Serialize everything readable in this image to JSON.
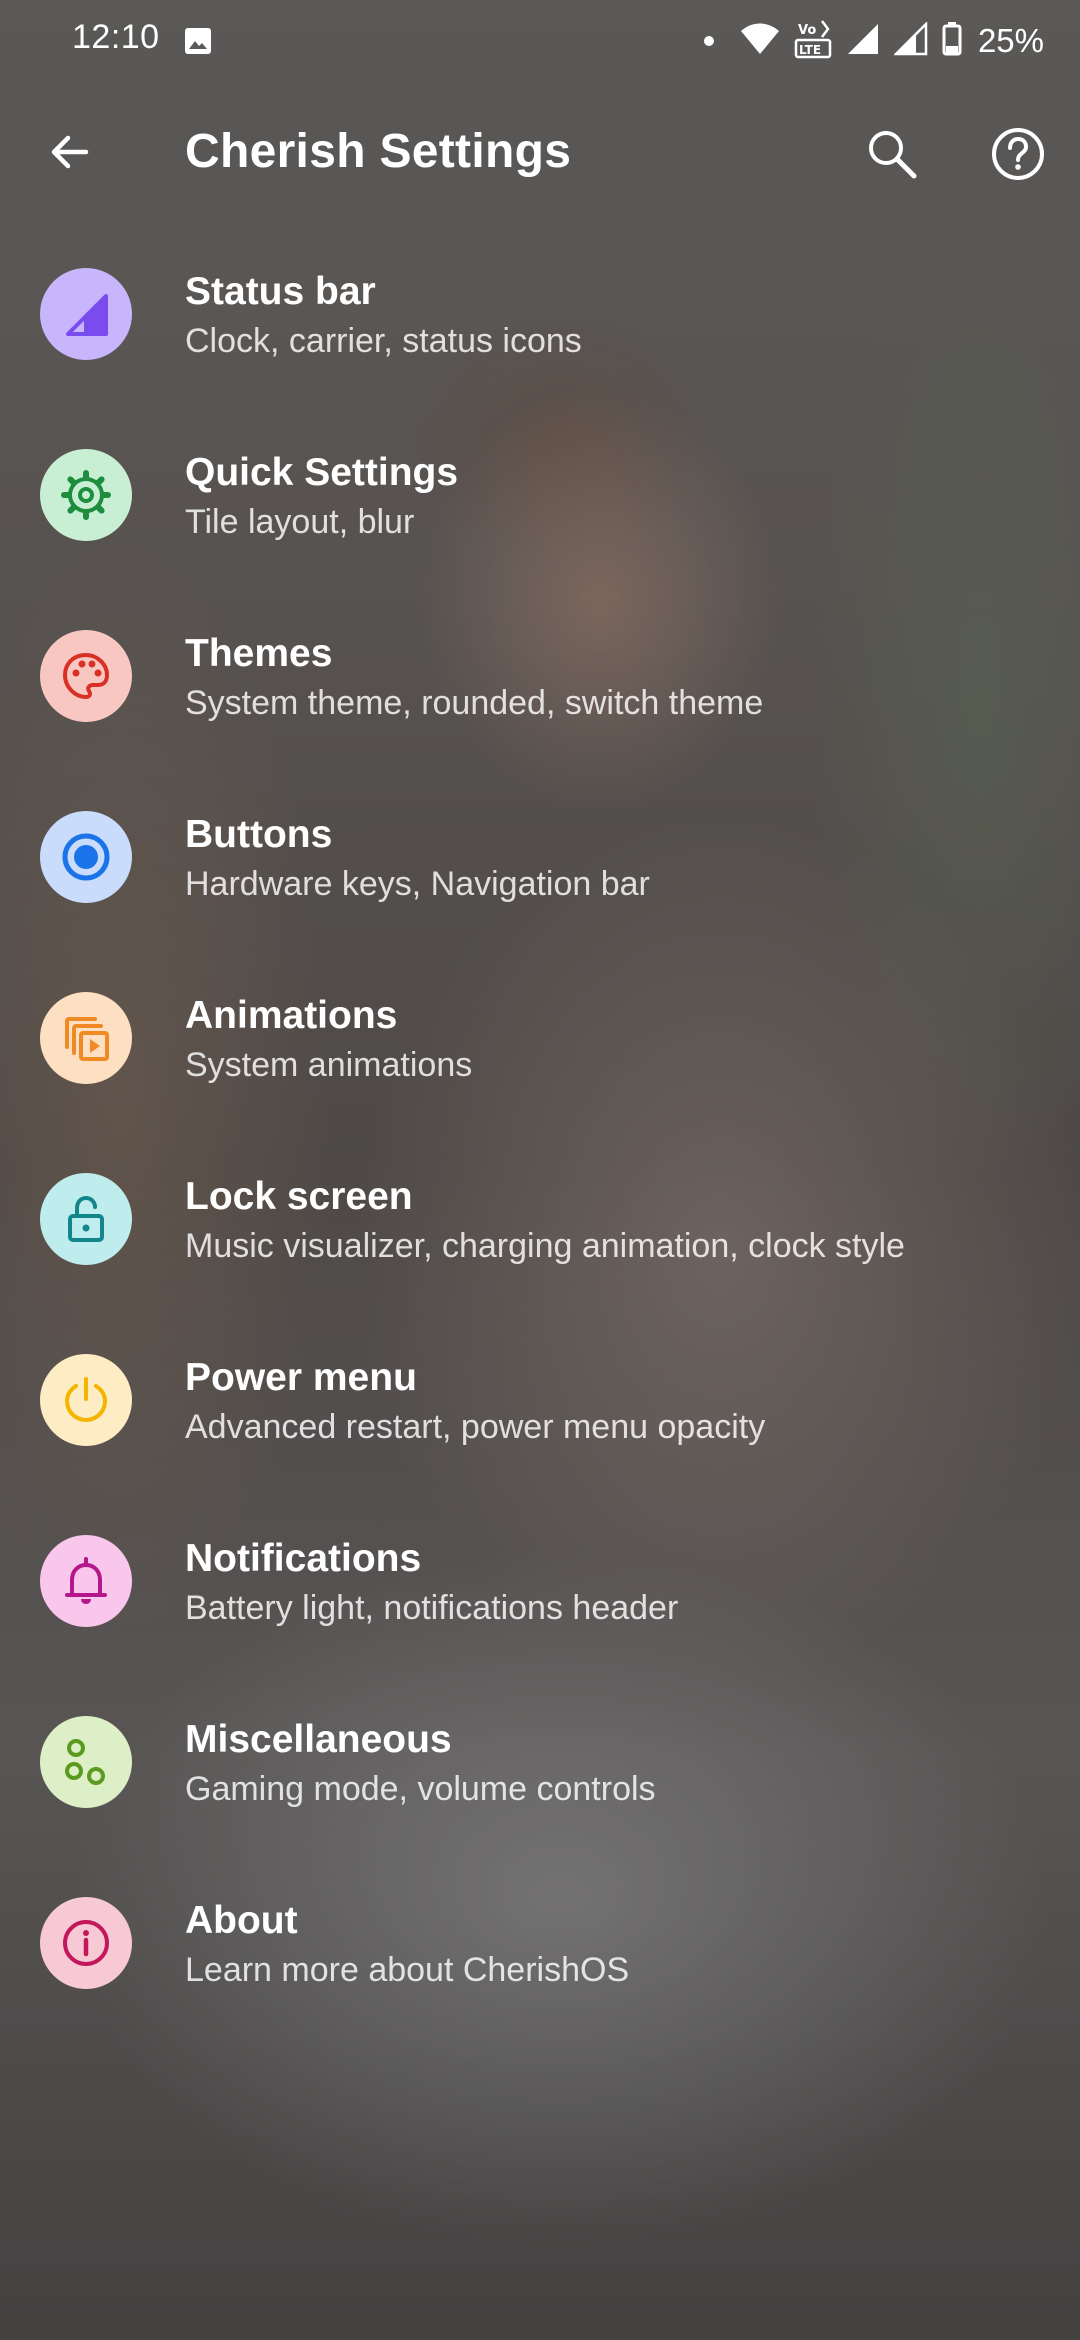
{
  "status_bar": {
    "time": "12:10",
    "battery": "25%",
    "icons": [
      "image-icon",
      "notification-dot-icon",
      "wifi-icon",
      "volte-lte-icon",
      "signal-icon",
      "signal-icon",
      "battery-icon"
    ]
  },
  "app_bar": {
    "title": "Cherish Settings",
    "back_icon": "arrow-back-icon",
    "search_icon": "search-icon",
    "help_icon": "help-icon"
  },
  "items": [
    {
      "title": "Status bar",
      "summary": "Clock, carrier, status icons",
      "icon": "status-bar-icon",
      "bg": "#c7b6fb",
      "fg": "#7a4cf0"
    },
    {
      "title": "Quick Settings",
      "summary": "Tile layout, blur",
      "icon": "gear-icon",
      "bg": "#c8efd3",
      "fg": "#1e8e3e"
    },
    {
      "title": "Themes",
      "summary": "System theme, rounded, switch theme",
      "icon": "palette-icon",
      "bg": "#f9c7c2",
      "fg": "#d93025"
    },
    {
      "title": "Buttons",
      "summary": "Hardware keys, Navigation bar",
      "icon": "radio-button-icon",
      "bg": "#c9dcfb",
      "fg": "#1a73e8"
    },
    {
      "title": "Animations",
      "summary": "System animations",
      "icon": "slideshow-icon",
      "bg": "#fde0c2",
      "fg": "#f08a24"
    },
    {
      "title": "Lock screen",
      "summary": "Music visualizer, charging animation, clock style",
      "icon": "lock-open-icon",
      "bg": "#bfecec",
      "fg": "#12868a"
    },
    {
      "title": "Power menu",
      "summary": "Advanced restart, power menu opacity",
      "icon": "power-icon",
      "bg": "#feecc4",
      "fg": "#f4b400"
    },
    {
      "title": "Notifications",
      "summary": "Battery light, notifications header",
      "icon": "bell-icon",
      "bg": "#f9c6ec",
      "fg": "#b5178a"
    },
    {
      "title": "Miscellaneous",
      "summary": "Gaming mode, volume controls",
      "icon": "bubbles-icon",
      "bg": "#dcefc6",
      "fg": "#5b9a1e"
    },
    {
      "title": "About",
      "summary": "Learn more about CherishOS",
      "icon": "info-icon",
      "bg": "#f7c9d5",
      "fg": "#c2185b"
    }
  ]
}
